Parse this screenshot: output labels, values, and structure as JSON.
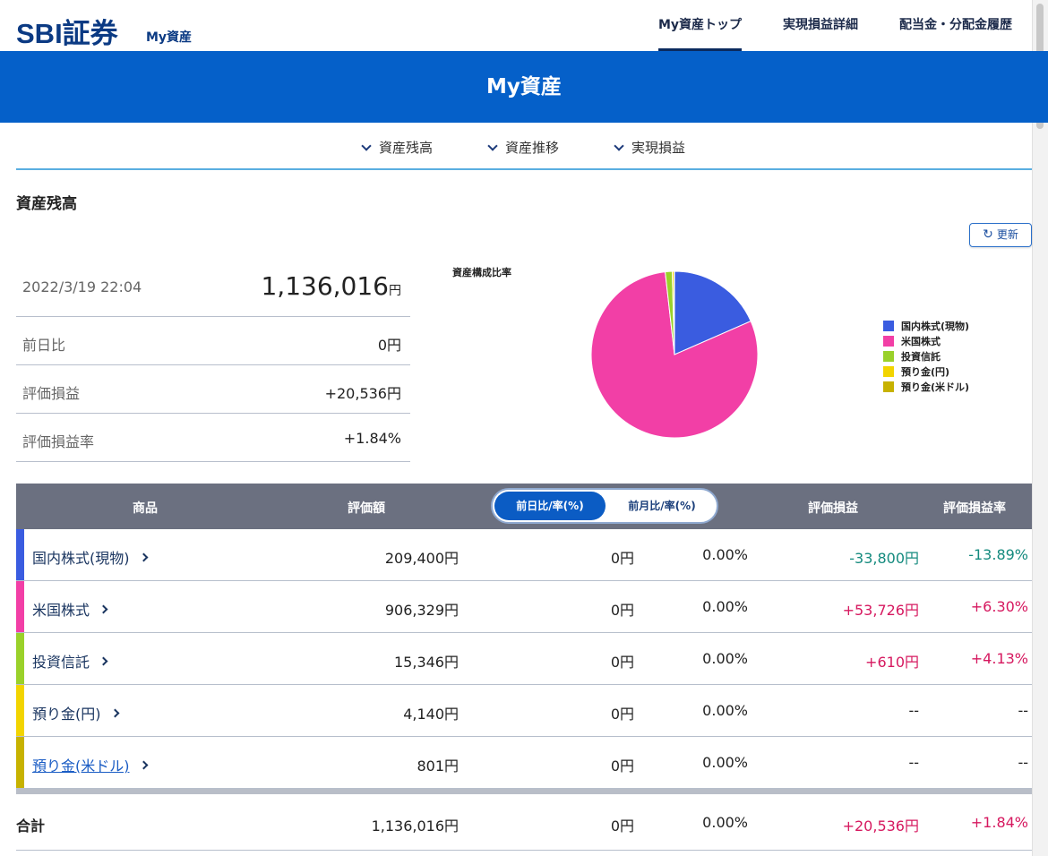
{
  "header": {
    "logo": "SBI証券",
    "logo_sub": "My資産",
    "nav": [
      {
        "label": "My資産トップ",
        "active": true
      },
      {
        "label": "実現損益詳細",
        "active": false
      },
      {
        "label": "配当金・分配金履歴",
        "active": false
      }
    ]
  },
  "banner": {
    "title": "My資産"
  },
  "subnav": [
    "資産残高",
    "資産推移",
    "実現損益"
  ],
  "section": {
    "title": "資産残高",
    "refresh_label": "更新",
    "refresh_icon": "refresh-icon"
  },
  "summary": {
    "datetime": "2022/3/19 22:04",
    "total_value": "1,136,016",
    "unit": "円",
    "rows": [
      {
        "label": "前日比",
        "value": "0円",
        "tone": ""
      },
      {
        "label": "評価損益",
        "value": "+20,536円",
        "tone": "pos"
      },
      {
        "label": "評価損益率",
        "value": "+1.84%",
        "tone": "pos"
      }
    ]
  },
  "chart_data": {
    "type": "pie",
    "title": "資産構成比率",
    "categories": [
      "国内株式(現物)",
      "米国株式",
      "投資信託",
      "預り金(円)",
      "預り金(米ドル)"
    ],
    "values": [
      209400,
      906329,
      15346,
      4140,
      801
    ],
    "colors": [
      "#3a5ce0",
      "#f23fa6",
      "#9ad12a",
      "#f2d400",
      "#c7b200"
    ],
    "legend_position": "right"
  },
  "table": {
    "headers": {
      "product": "商品",
      "value": "評価額",
      "toggle_day": "前日比/率(%)",
      "toggle_month": "前月比/率(%)",
      "pl": "評価損益",
      "pl_rate": "評価損益率"
    },
    "rows": [
      {
        "name": "国内株式(現物)",
        "value": "209,400円",
        "diff": "0円",
        "pct": "0.00%",
        "pl": "-33,800円",
        "pl_rate": "-13.89%",
        "tone": "neg",
        "color": "#3a5ce0",
        "link": false
      },
      {
        "name": "米国株式",
        "value": "906,329円",
        "diff": "0円",
        "pct": "0.00%",
        "pl": "+53,726円",
        "pl_rate": "+6.30%",
        "tone": "pos",
        "color": "#f23fa6",
        "link": false
      },
      {
        "name": "投資信託",
        "value": "15,346円",
        "diff": "0円",
        "pct": "0.00%",
        "pl": "+610円",
        "pl_rate": "+4.13%",
        "tone": "pos",
        "color": "#9ad12a",
        "link": false
      },
      {
        "name": "預り金(円)",
        "value": "4,140円",
        "diff": "0円",
        "pct": "0.00%",
        "pl": "--",
        "pl_rate": "--",
        "tone": "",
        "color": "#f2d400",
        "link": false
      },
      {
        "name": "預り金(米ドル)",
        "value": "801円",
        "diff": "0円",
        "pct": "0.00%",
        "pl": "--",
        "pl_rate": "--",
        "tone": "",
        "color": "#c7b200",
        "link": true
      }
    ],
    "total": {
      "name": "合計",
      "value": "1,136,016円",
      "diff": "0円",
      "pct": "0.00%",
      "pl": "+20,536円",
      "pl_rate": "+1.84%",
      "tone": "pos"
    }
  }
}
